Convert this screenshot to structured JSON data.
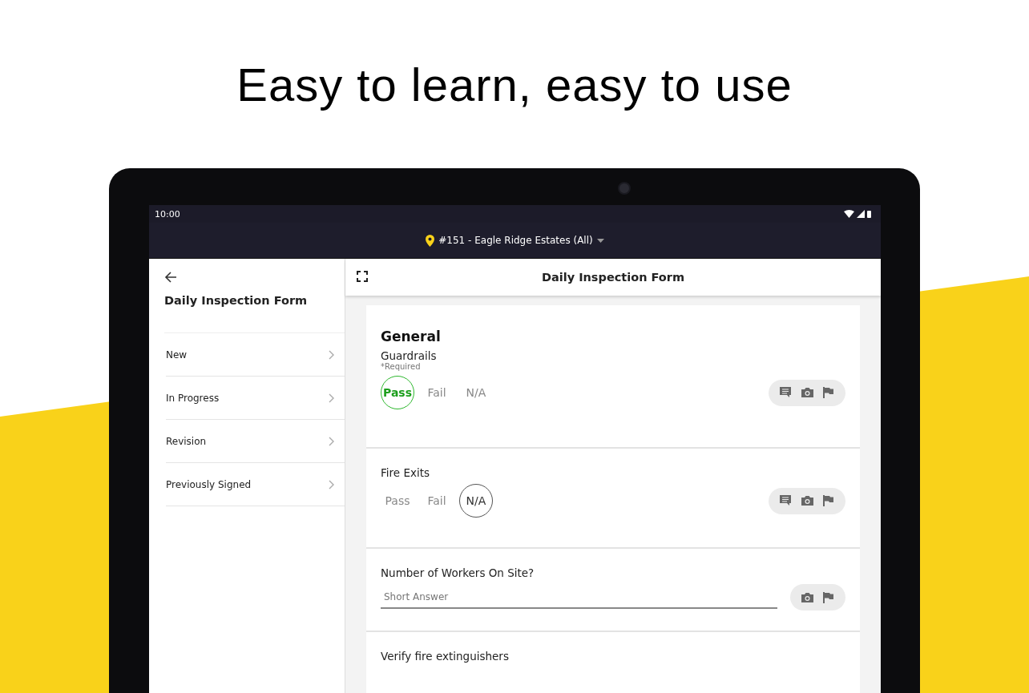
{
  "headline": "Easy to learn, easy to use",
  "status_bar": {
    "time": "10:00"
  },
  "location_bar": {
    "label": "#151 - Eagle Ridge Estates (All)"
  },
  "sidebar": {
    "title": "Daily Inspection Form",
    "items": [
      {
        "label": "New"
      },
      {
        "label": "In Progress"
      },
      {
        "label": "Revision"
      },
      {
        "label": "Previously Signed"
      }
    ]
  },
  "main": {
    "title": "Daily Inspection Form",
    "section": "General",
    "questions": [
      {
        "kind": "pass_fail",
        "label": "Guardrails",
        "note": "*Required",
        "options": [
          {
            "label": "Pass",
            "selected": true
          },
          {
            "label": "Fail",
            "selected": false
          },
          {
            "label": "N/A",
            "selected": false
          }
        ]
      },
      {
        "kind": "pass_fail",
        "label": "Fire Exits",
        "options": [
          {
            "label": "Pass",
            "selected": false
          },
          {
            "label": "Fail",
            "selected": false
          },
          {
            "label": "N/A",
            "selected": true
          }
        ]
      },
      {
        "kind": "short_answer",
        "label": "Number of Workers On Site?",
        "placeholder": "Short Answer"
      },
      {
        "kind": "heading_only",
        "label": "Verify fire extinguishers"
      }
    ]
  }
}
